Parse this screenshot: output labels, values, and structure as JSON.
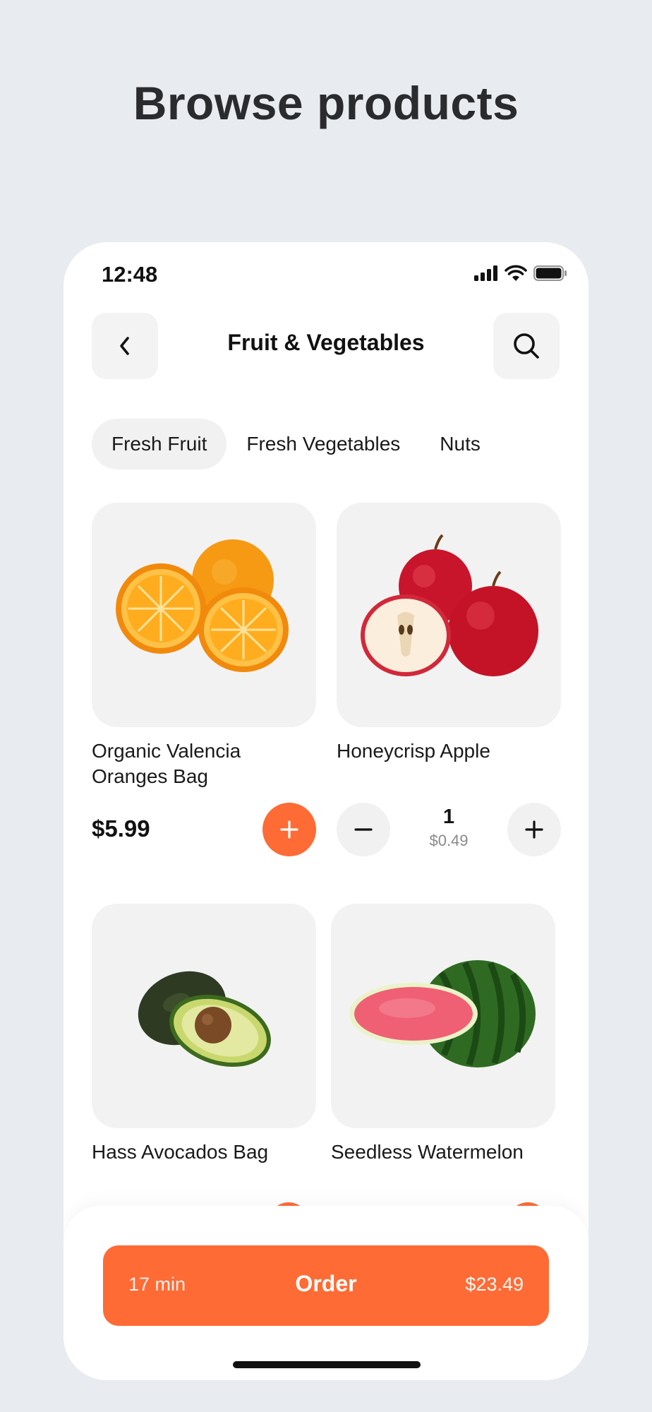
{
  "headline": "Browse products",
  "status": {
    "time": "12:48"
  },
  "nav": {
    "title": "Fruit & Vegetables",
    "back_icon": "chevron-left-icon",
    "search_icon": "search-icon"
  },
  "tabs": [
    {
      "label": "Fresh Fruit",
      "active": true
    },
    {
      "label": "Fresh Vegetables",
      "active": false
    },
    {
      "label": "Nuts",
      "active": false
    }
  ],
  "products": [
    {
      "name_line1": "Organic Valencia",
      "name_line2": "Oranges Bag",
      "price": "$5.99"
    },
    {
      "name": "Honeycrisp Apple",
      "quantity": "1",
      "unit_price": "$0.49"
    },
    {
      "name": "Hass Avocados Bag"
    },
    {
      "name": "Seedless Watermelon"
    }
  ],
  "order": {
    "eta": "17 min",
    "label": "Order",
    "total": "$23.49"
  },
  "colors": {
    "accent": "#FF6B35",
    "page_bg": "#E8EBEF",
    "card_bg": "#F2F2F2"
  }
}
